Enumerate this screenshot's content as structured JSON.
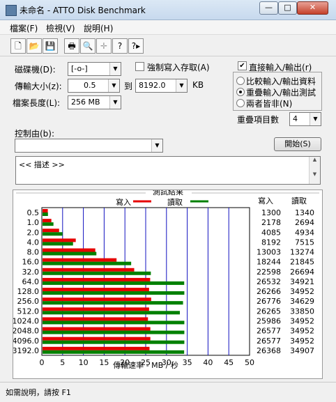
{
  "window": {
    "title": "未命名 - ATTO Disk Benchmark",
    "minimize": "—",
    "maximize": "□",
    "close": "✕"
  },
  "menu": [
    "檔案(F)",
    "檢視(V)",
    "說明(H)"
  ],
  "toolbar": [
    "🗋",
    "📂",
    "💾",
    "🖶",
    "🔍",
    "✛",
    "?",
    "?▸"
  ],
  "form": {
    "drive_label": "磁碟機(D):",
    "drive_value": "[-o-]",
    "transfer_label": "傳輸大小(z):",
    "transfer_from": "0.5",
    "to_label": "到",
    "transfer_to": "8192.0",
    "kb_label": "KB",
    "file_length_label": "檔案長度(L):",
    "file_length_value": "256 MB",
    "force_write_label": "強制寫入存取(A)",
    "direct_io_label": "直接輸入/輸出(r)",
    "direct_io_checked": "✔",
    "radio_compare": "比較輸入/輸出資料",
    "radio_overlap": "重疊輸入/輸出測試",
    "radio_neither": "兩者皆非(N)",
    "queue_label": "重疊項目數",
    "queue_value": "4",
    "controlled_by_label": "控制由(b):",
    "start_button": "開始(S)",
    "description": "<<   描述   >>"
  },
  "chart_data": {
    "type": "bar",
    "title": "測試結果",
    "legend": {
      "write": "寫入",
      "read": "讀取"
    },
    "xlabel": "傳輸速率 - MB / 秒",
    "xlim": [
      0,
      50
    ],
    "xticks": [
      0,
      5,
      10,
      15,
      20,
      25,
      30,
      35,
      40,
      45,
      50
    ],
    "col_write": "寫入",
    "col_read": "讀取",
    "categories": [
      "0.5",
      "1.0",
      "2.0",
      "4.0",
      "8.0",
      "16.0",
      "32.0",
      "64.0",
      "128.0",
      "256.0",
      "512.0",
      "1024.0",
      "2048.0",
      "4096.0",
      "3192.0"
    ],
    "write_kbs": [
      1300,
      2178,
      4085,
      8192,
      13003,
      18244,
      22598,
      26532,
      26266,
      26776,
      26265,
      25986,
      26577,
      26577,
      26368
    ],
    "read_kbs": [
      1340,
      2694,
      4934,
      7515,
      13274,
      21845,
      26694,
      34921,
      34952,
      34629,
      33850,
      34952,
      34952,
      34952,
      34907
    ],
    "write_color": "#e60000",
    "read_color": "#008000"
  },
  "status": "如需說明，請按 F1"
}
